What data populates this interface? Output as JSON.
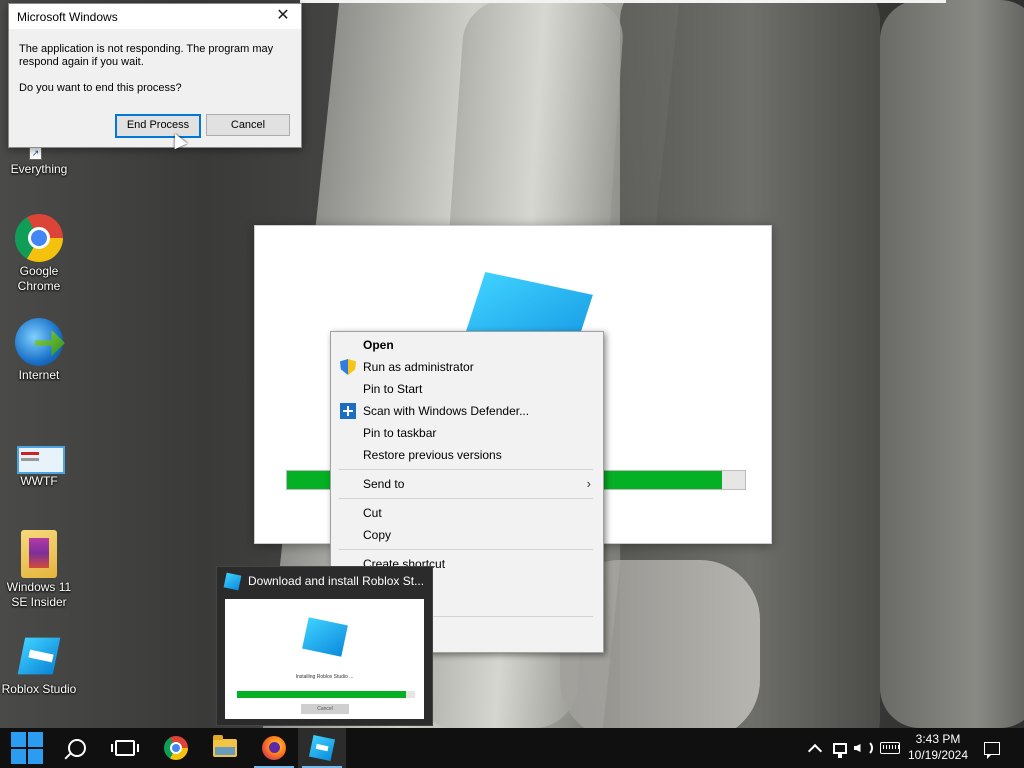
{
  "desktop": {
    "icons": [
      {
        "label": "Everything",
        "icon": "everything-icon"
      },
      {
        "label": "Google\nChrome",
        "icon": "chrome-icon"
      },
      {
        "label": "Internet",
        "icon": "internet-download-manager-icon"
      },
      {
        "label": "WWTF",
        "icon": "wwtf-icon"
      },
      {
        "label": "Windows 11\nSE Insider",
        "icon": "winrar-archive-icon"
      },
      {
        "label": "Roblox Studio",
        "icon": "roblox-studio-icon"
      }
    ]
  },
  "dialog": {
    "title": "Microsoft Windows",
    "message": "The application is not responding. The program may respond again if you wait.",
    "question": "Do you want to end this process?",
    "end_button": "End Process",
    "cancel_button": "Cancel"
  },
  "installer": {
    "progress_fraction": 0.95
  },
  "context_menu": {
    "items": [
      {
        "label": "Open",
        "bold": true
      },
      {
        "label": "Run as administrator",
        "icon": "uac-shield-icon"
      },
      {
        "label": "Pin to Start"
      },
      {
        "label": "Scan with Windows Defender...",
        "icon": "windows-defender-icon"
      },
      {
        "label": "Pin to taskbar"
      },
      {
        "label": "Restore previous versions"
      },
      {
        "label": "Send to",
        "submenu": true
      },
      {
        "label": "Cut"
      },
      {
        "label": "Copy"
      },
      {
        "label": "Create shortcut"
      }
    ]
  },
  "thumbnail": {
    "title": "Download and install Roblox St...",
    "status": "Installing Roblox Studio ...",
    "cancel": "Cancel",
    "progress_fraction": 0.95
  },
  "taskbar": {
    "time": "3:43 PM",
    "date": "10/19/2024"
  },
  "colors": {
    "accent": "#0078d7",
    "progress_green": "#06b025",
    "roblox_blue": "#0b8bdc"
  }
}
